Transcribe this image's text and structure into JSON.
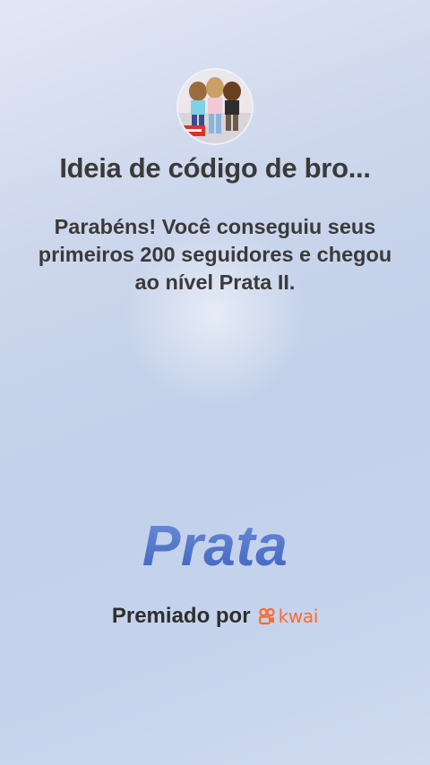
{
  "header": {
    "title": "Ideia de código de bro..."
  },
  "message": {
    "text": "Parabéns! Você conseguiu seus primeiros 200 seguidores e chegou ao nível Prata II."
  },
  "level": {
    "name": "Prata"
  },
  "footer": {
    "awarded_by": "Premiado por",
    "brand": "kwai",
    "brand_icon": "kwai-logo-icon"
  },
  "colors": {
    "level_blue": "#4a6fc4",
    "brand_orange": "#ff6a2a",
    "text": "#3a3a3a"
  }
}
